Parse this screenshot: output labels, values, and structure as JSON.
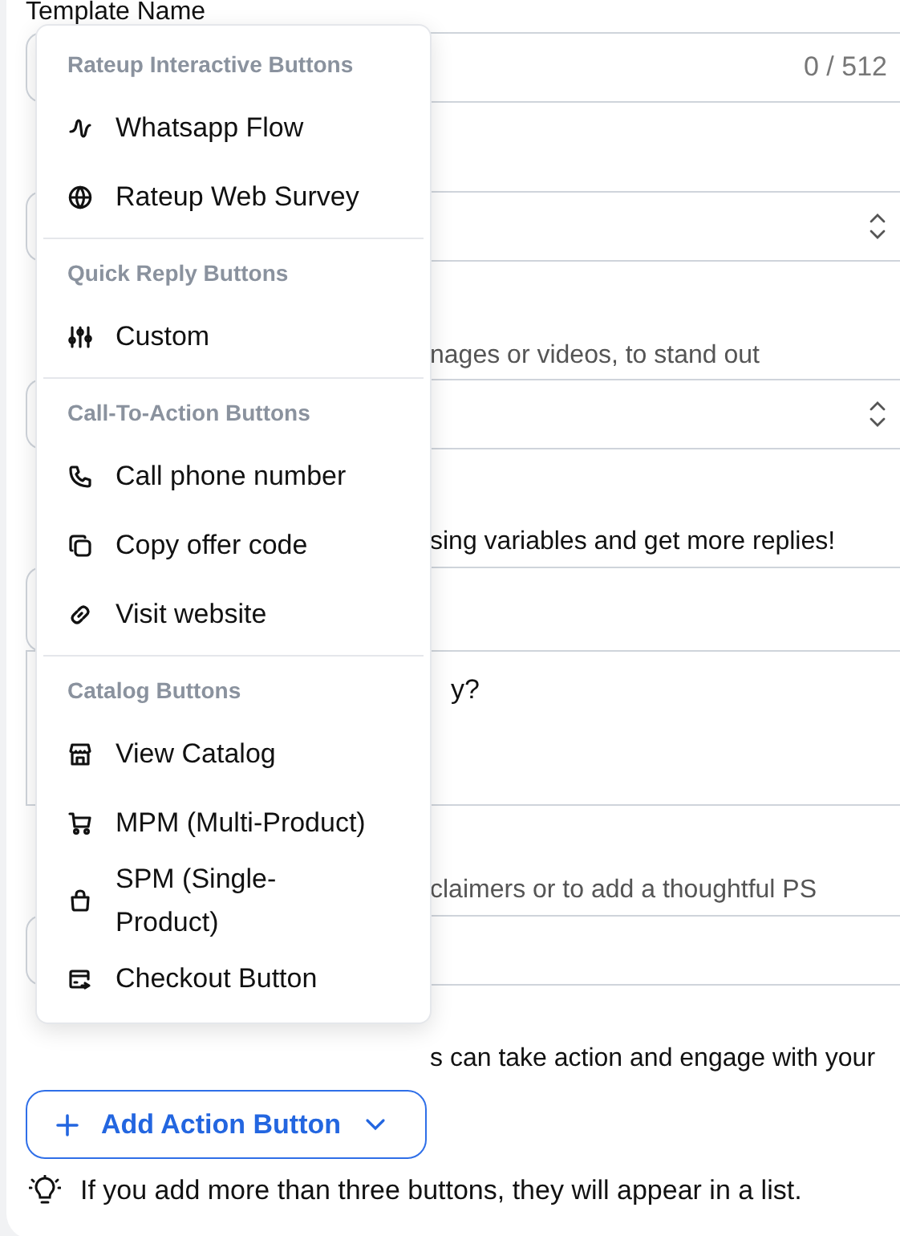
{
  "form": {
    "rows": [
      {
        "kind": "label",
        "text": "Template Name"
      },
      {
        "kind": "input",
        "counter": "0 / 512"
      },
      {
        "kind": "select"
      },
      {
        "kind": "hint",
        "text": "nages or videos, to stand out"
      },
      {
        "kind": "select"
      },
      {
        "kind": "note",
        "text": "sing variables and get more replies!"
      },
      {
        "kind": "input"
      },
      {
        "kind": "textarea",
        "value": "y?"
      },
      {
        "kind": "hint",
        "text": "claimers or to add a thoughtful PS"
      },
      {
        "kind": "input"
      },
      {
        "kind": "note",
        "text": "s can take action and engage with your"
      }
    ]
  },
  "add_button": {
    "label": "Add Action Button",
    "expanded": true
  },
  "tip": "If you add more than three buttons, they will appear in a list.",
  "menu": {
    "sections": [
      {
        "header": "Rateup Interactive Buttons",
        "items": [
          {
            "label": "Whatsapp Flow"
          },
          {
            "label": "Rateup Web Survey"
          }
        ]
      },
      {
        "header": "Quick Reply Buttons",
        "items": [
          {
            "label": "Custom"
          }
        ]
      },
      {
        "header": "Call-To-Action Buttons",
        "items": [
          {
            "label": "Call phone number"
          },
          {
            "label": "Copy offer code"
          },
          {
            "label": "Visit website"
          }
        ]
      },
      {
        "header": "Catalog Buttons",
        "items": [
          {
            "label": "View Catalog"
          },
          {
            "label": "MPM (Multi-Product)"
          },
          {
            "label": "SPM (Single-Product)"
          },
          {
            "label": "Checkout Button"
          }
        ]
      }
    ]
  }
}
